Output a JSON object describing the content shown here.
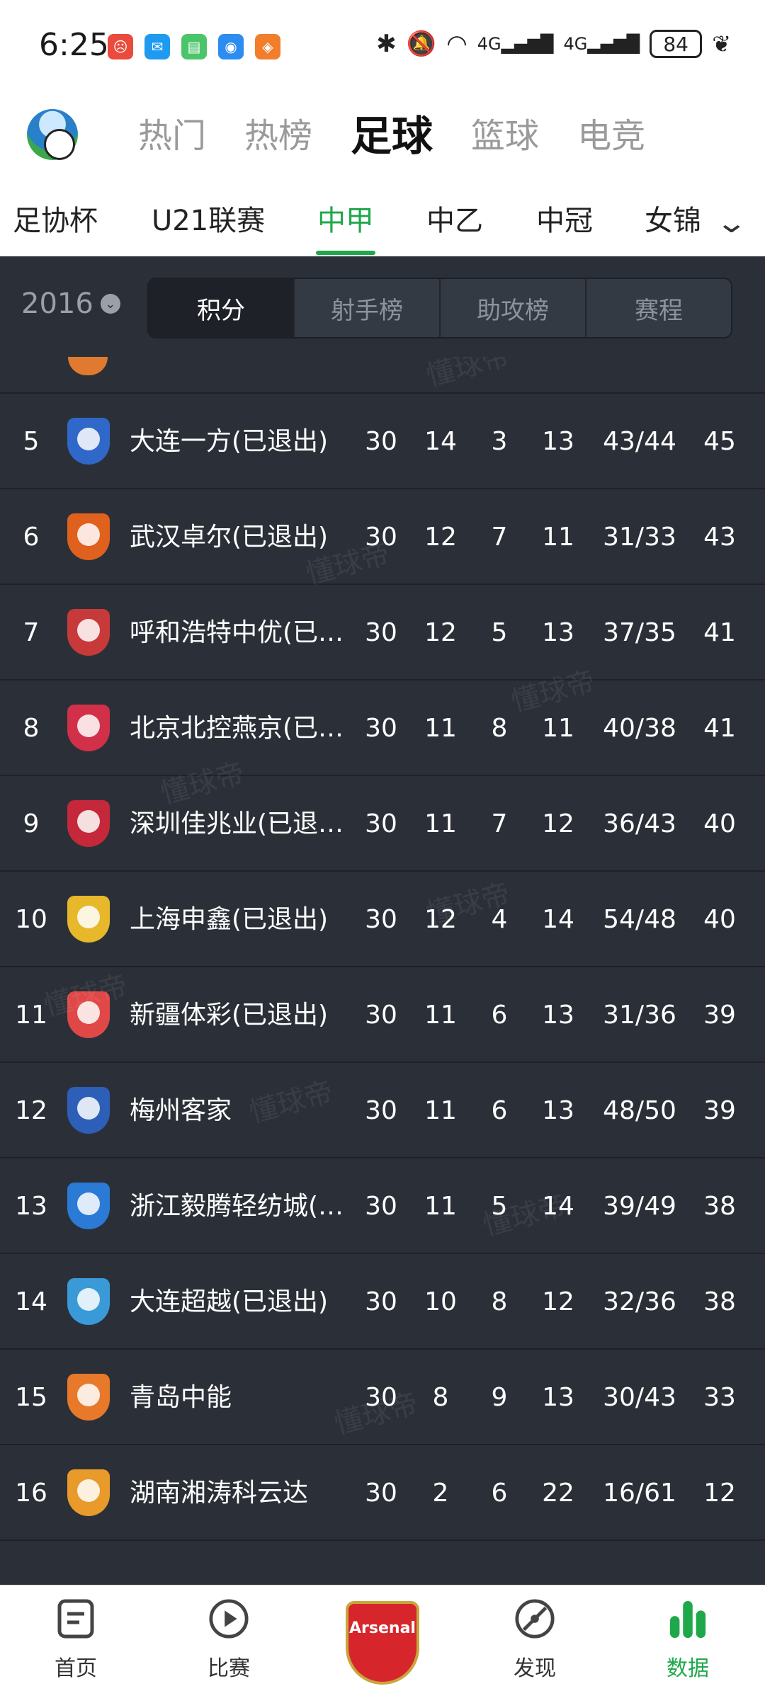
{
  "status_bar": {
    "time": "6:25",
    "apps": [
      {
        "name": "missed-call-app",
        "color": "#ea4b3c",
        "glyph": "☹"
      },
      {
        "name": "message-app",
        "color": "#1e9bf0",
        "glyph": "✉"
      },
      {
        "name": "sim-app",
        "color": "#4cc56a",
        "glyph": "▤"
      },
      {
        "name": "hotspot-app",
        "color": "#2d8cf0",
        "glyph": "◉"
      },
      {
        "name": "shop-app",
        "color": "#f27d2b",
        "glyph": "◈"
      }
    ],
    "battery": "84",
    "network_left": "4G",
    "network_right": "4G"
  },
  "header": {
    "main_tabs": [
      "热门",
      "热榜",
      "足球",
      "篮球",
      "电竞"
    ],
    "active_main": "足球",
    "sub_tabs": [
      "足协杯",
      "U21联赛",
      "中甲",
      "中乙",
      "中冠",
      "女锦"
    ],
    "active_sub": "中甲"
  },
  "filter": {
    "season": "2016",
    "segments": [
      "积分",
      "射手榜",
      "助攻榜",
      "赛程"
    ],
    "active_segment": "积分"
  },
  "table": {
    "rows": [
      {
        "rank": "5",
        "name": "大连一方(已退出)",
        "p": "30",
        "w": "14",
        "d": "3",
        "l": "13",
        "g": "43/44",
        "pts": "45",
        "crest_color": "#2f68c8"
      },
      {
        "rank": "6",
        "name": "武汉卓尔(已退出)",
        "p": "30",
        "w": "12",
        "d": "7",
        "l": "11",
        "g": "31/33",
        "pts": "43",
        "crest_color": "#e0601e"
      },
      {
        "rank": "7",
        "name": "呼和浩特中优(已…",
        "p": "30",
        "w": "12",
        "d": "5",
        "l": "13",
        "g": "37/35",
        "pts": "41",
        "crest_color": "#c83a3a"
      },
      {
        "rank": "8",
        "name": "北京北控燕京(已…",
        "p": "30",
        "w": "11",
        "d": "8",
        "l": "11",
        "g": "40/38",
        "pts": "41",
        "crest_color": "#d13048"
      },
      {
        "rank": "9",
        "name": "深圳佳兆业(已退出)",
        "p": "30",
        "w": "11",
        "d": "7",
        "l": "12",
        "g": "36/43",
        "pts": "40",
        "crest_color": "#c4283a"
      },
      {
        "rank": "10",
        "name": "上海申鑫(已退出)",
        "p": "30",
        "w": "12",
        "d": "4",
        "l": "14",
        "g": "54/48",
        "pts": "40",
        "crest_color": "#e6b82a"
      },
      {
        "rank": "11",
        "name": "新疆体彩(已退出)",
        "p": "30",
        "w": "11",
        "d": "6",
        "l": "13",
        "g": "31/36",
        "pts": "39",
        "crest_color": "#e04848"
      },
      {
        "rank": "12",
        "name": "梅州客家",
        "p": "30",
        "w": "11",
        "d": "6",
        "l": "13",
        "g": "48/50",
        "pts": "39",
        "crest_color": "#2d5fb8"
      },
      {
        "rank": "13",
        "name": "浙江毅腾轻纺城(…",
        "p": "30",
        "w": "11",
        "d": "5",
        "l": "14",
        "g": "39/49",
        "pts": "38",
        "crest_color": "#2a7ad6"
      },
      {
        "rank": "14",
        "name": "大连超越(已退出)",
        "p": "30",
        "w": "10",
        "d": "8",
        "l": "12",
        "g": "32/36",
        "pts": "38",
        "crest_color": "#3a9ad8"
      },
      {
        "rank": "15",
        "name": "青岛中能",
        "p": "30",
        "w": "8",
        "d": "9",
        "l": "13",
        "g": "30/43",
        "pts": "33",
        "crest_color": "#e8782a"
      },
      {
        "rank": "16",
        "name": "湖南湘涛科云达",
        "p": "30",
        "w": "2",
        "d": "6",
        "l": "22",
        "g": "16/61",
        "pts": "12",
        "crest_color": "#e89a2a"
      }
    ]
  },
  "watermark_text": "懂球帝",
  "bottom_nav": {
    "items": [
      "首页",
      "比赛",
      "发现",
      "数据"
    ],
    "center_badge": "Arsenal",
    "active": "数据"
  },
  "colors": {
    "accent": "#1fa84a",
    "table_bg": "#2b3038",
    "divider": "#1e2228"
  }
}
